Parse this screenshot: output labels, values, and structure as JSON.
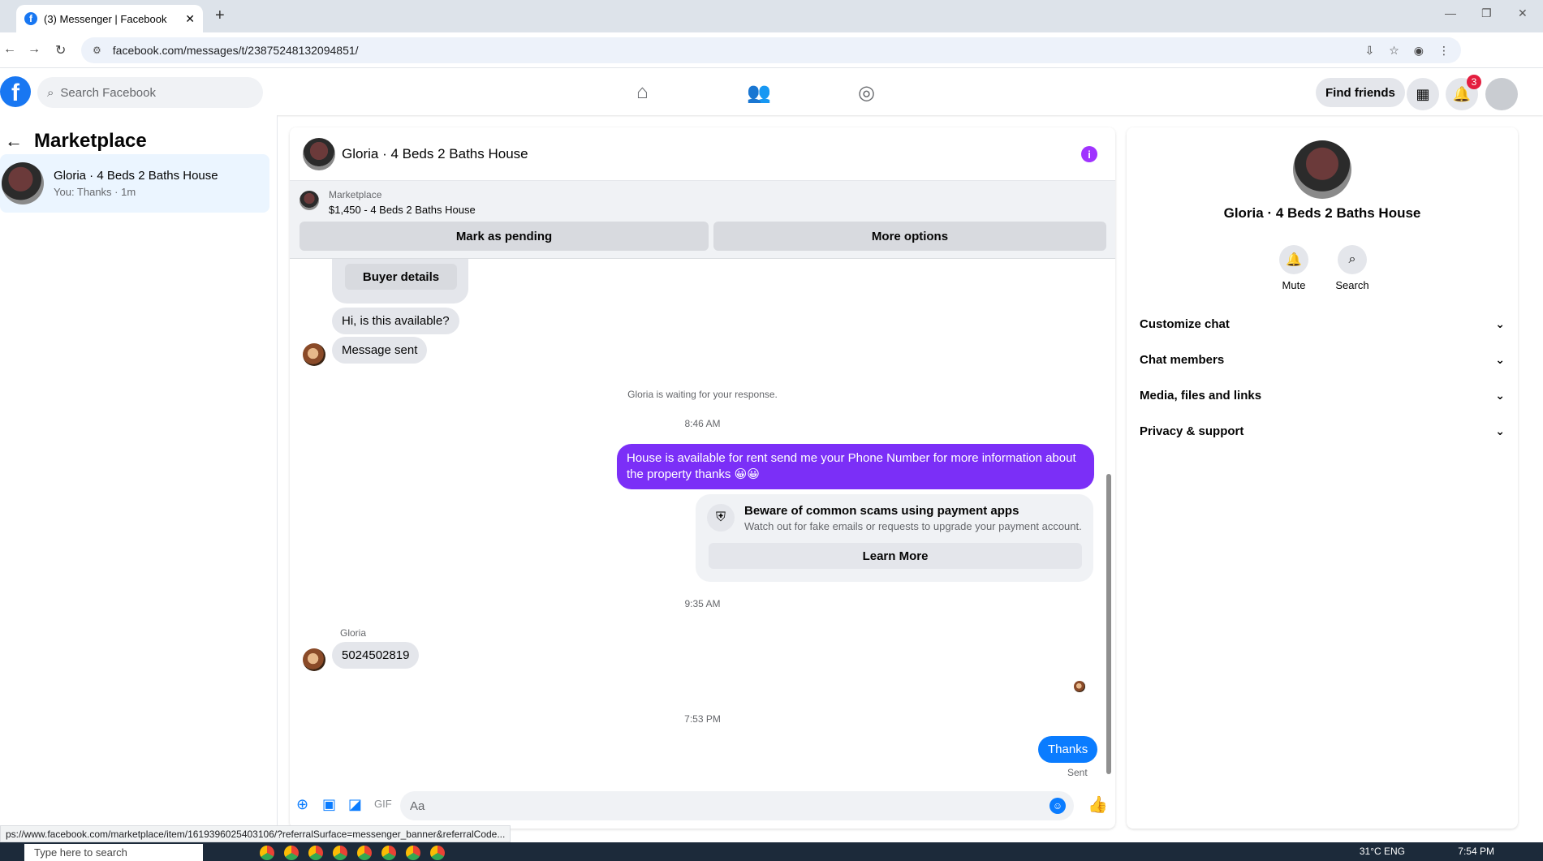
{
  "browser": {
    "tab_title": "(3) Messenger | Facebook",
    "url": "facebook.com/messages/t/23875248132094851/",
    "status_url": "ps://www.facebook.com/marketplace/item/1619396025403106/?referralSurface=messenger_banner&referralCode..."
  },
  "header": {
    "search_placeholder": "Search Facebook",
    "find_friends_label": "Find friends",
    "notification_count": "3"
  },
  "left": {
    "title": "Marketplace",
    "conversation": {
      "name": "Gloria · 4 Beds 2 Baths House",
      "preview": "You: Thanks · 1m"
    }
  },
  "chat": {
    "title": "Gloria · 4 Beds 2 Baths House",
    "marketplace_label": "Marketplace",
    "listing": "$1,450 - 4 Beds 2 Baths House",
    "mark_pending_label": "Mark as pending",
    "more_options_label": "More options",
    "buyer_details_label": "Buyer details",
    "messages": {
      "m1": "Hi, is this available?",
      "m2": "Message sent",
      "waiting": "Gloria is waiting for your response.",
      "time1": "8:46 AM",
      "out1_line1": "House is available for rent send me your Phone Number for more information about",
      "out1_line2": "the property thanks 😀😀",
      "scam_title": "Beware of common scams using payment apps",
      "scam_text": "Watch out for fake emails or requests to upgrade your payment account.",
      "learn_more": "Learn More",
      "time2": "9:35 AM",
      "sender": "Gloria",
      "m3": "5024502819",
      "time3": "7:53 PM",
      "out2": "Thanks",
      "sent_status": "Sent"
    },
    "composer_placeholder": "Aa"
  },
  "right": {
    "name": "Gloria · 4 Beds 2 Baths House",
    "mute_label": "Mute",
    "search_label": "Search",
    "sections": [
      "Customize chat",
      "Chat members",
      "Media, files and links",
      "Privacy & support"
    ]
  },
  "taskbar": {
    "search_placeholder": "Type here to search",
    "clock": "7:54 PM",
    "tray": "31°C   ENG"
  },
  "colors": {
    "brand": "#1877f2",
    "outgoing_bubble": "#7b2ff7",
    "messenger_blue": "#0a7cff"
  }
}
